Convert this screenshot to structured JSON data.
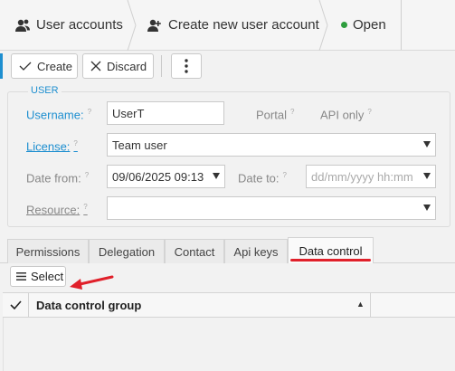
{
  "breadcrumb": {
    "items": [
      {
        "label": "User accounts",
        "icon": "users-icon"
      },
      {
        "label": "Create new user account",
        "icon": "add-user-icon"
      }
    ],
    "status": {
      "label": "Open",
      "color": "#2e9e3e"
    }
  },
  "toolbar": {
    "create_label": "Create",
    "discard_label": "Discard",
    "more_icon": "vertical-ellipsis-icon",
    "accent_color": "#1e8fd0"
  },
  "user_section": {
    "legend": "USER",
    "username": {
      "label": "Username:",
      "value": "UserT"
    },
    "portal_label": "Portal",
    "api_only_label": "API only",
    "help_mark": "?",
    "license": {
      "label": "License:",
      "value": "Team user"
    },
    "date_from": {
      "label": "Date from:",
      "value": "09/06/2025 09:13"
    },
    "date_to": {
      "label": "Date to:",
      "placeholder": "dd/mm/yyyy hh:mm"
    },
    "resource": {
      "label": "Resource:",
      "value": ""
    }
  },
  "tabs": [
    {
      "label": "Permissions"
    },
    {
      "label": "Delegation"
    },
    {
      "label": "Contact"
    },
    {
      "label": "Api keys"
    },
    {
      "label": "Data control",
      "active": true
    }
  ],
  "data_control": {
    "select_label": "Select",
    "column_header": "Data control group",
    "sort_indicator": "▲",
    "highlight_color": "#e0202a"
  }
}
